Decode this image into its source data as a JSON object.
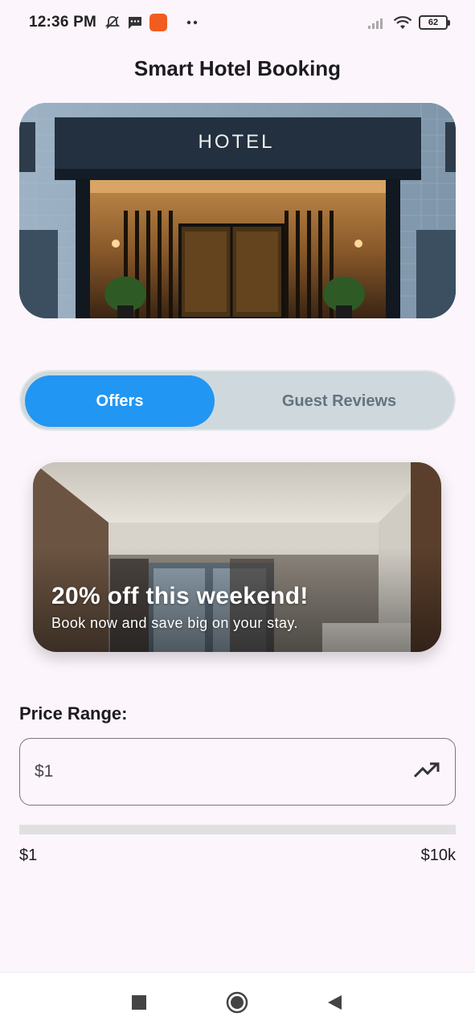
{
  "status_bar": {
    "time": "12:36 PM",
    "battery": "62",
    "icons": [
      "bell-off-icon",
      "message-icon",
      "app-notification-icon",
      "more-dots-icon",
      "signal-icon",
      "wifi-icon",
      "battery-icon"
    ]
  },
  "header": {
    "title": "Smart Hotel Booking"
  },
  "hero": {
    "sign_text": "HOTEL"
  },
  "tabs": [
    {
      "label": "Offers",
      "active": true
    },
    {
      "label": "Guest Reviews",
      "active": false
    }
  ],
  "offer": {
    "headline": "20% off this weekend!",
    "subtitle": "Book now and save big on your stay."
  },
  "price": {
    "label": "Price Range:",
    "value": "$1",
    "icon": "trending-up-icon",
    "range_min": "$1",
    "range_max": "$10k",
    "fill_fraction": 0
  },
  "nav": {
    "buttons": [
      "recents-square-icon",
      "home-circle-icon",
      "back-triangle-icon"
    ]
  },
  "colors": {
    "accent": "#2196f3",
    "background": "#fcf5fc",
    "tab_track": "#cfd8dc",
    "tab_inactive_text": "#637380"
  }
}
